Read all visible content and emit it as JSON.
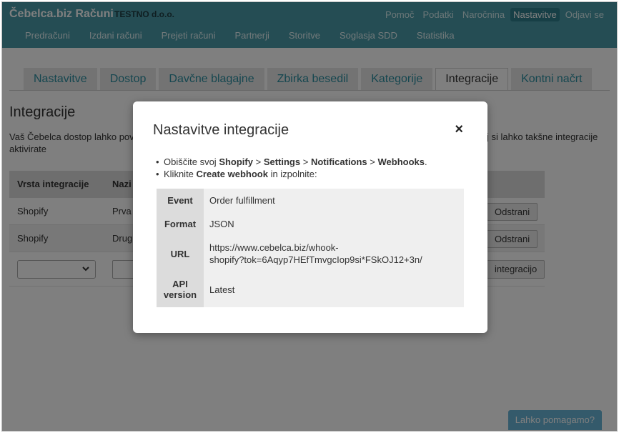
{
  "header": {
    "brand": "Čebelca.biz Računi",
    "company": "TESTNO d.o.o.",
    "user_nav": [
      "Pomoč",
      "Podatki",
      "Naročnina",
      "Nastavitve",
      "Odjavi se"
    ],
    "user_nav_active": "Nastavitve",
    "main_nav": [
      "Predračuni",
      "Izdani računi",
      "Prejeti računi",
      "Partnerji",
      "Storitve",
      "Soglasja SDD",
      "Statistika"
    ]
  },
  "tabs": [
    "Nastavitve",
    "Dostop",
    "Davčne blagajne",
    "Zbirka besedil",
    "Kategorije",
    "Integracije",
    "Kontni načrt"
  ],
  "active_tab": "Integracije",
  "page": {
    "title": "Integracije",
    "description_start": "Vaš Čebelca dostop lahko pov",
    "description_end_line1": "j si lahko takšne integracije",
    "description_line2": "aktivirate"
  },
  "table": {
    "headers": [
      "Vrsta integracije",
      "Nazi"
    ],
    "rows": [
      {
        "type": "Shopify",
        "name": "Prva",
        "action": "Odstrani"
      },
      {
        "type": "Shopify",
        "name": "Drug",
        "action": "Odstrani"
      }
    ],
    "add_button": "integracijo"
  },
  "modal": {
    "title": "Nastavitve integracije",
    "close_symbol": "×",
    "step1": {
      "prefix": "Obiščite svoj ",
      "shopify": "Shopify",
      "sep1": " > ",
      "settings": "Settings",
      "sep2": " > ",
      "notifications": "Notifications",
      "sep3": " > ",
      "webhooks": "Webhooks",
      "suffix": "."
    },
    "step2": {
      "prefix": "Kliknite ",
      "action": "Create webhook",
      "suffix": " in izpolnite:"
    },
    "fields": [
      {
        "key": "Event",
        "value": "Order fulfillment"
      },
      {
        "key": "Format",
        "value": "JSON"
      },
      {
        "key": "URL",
        "value": "https://www.cebelca.biz/whook-shopify?tok=6Aqyp7HEfTmvgcIop9si*FSkOJ12+3n/"
      },
      {
        "key": "API version",
        "value": "Latest"
      }
    ]
  },
  "help_button": "Lahko pomagamo?",
  "colors": {
    "header_bg": "#4a9aa8",
    "tab_link": "#2c8ea0",
    "help_bg": "#68b4d6"
  }
}
